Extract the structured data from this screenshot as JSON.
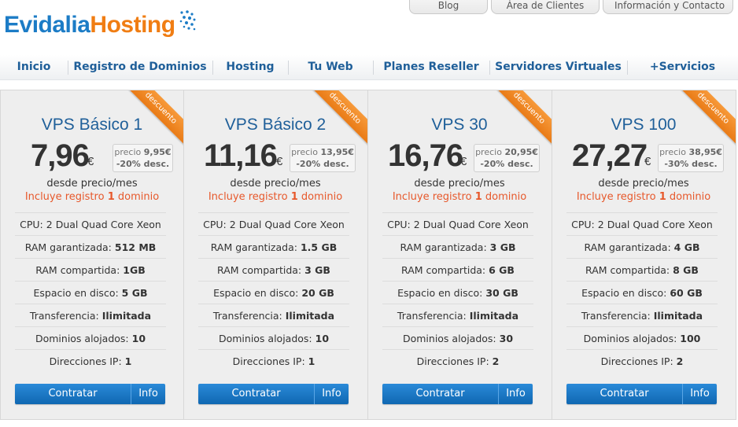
{
  "brand": {
    "part1": "Evidalia",
    "part2": "Hosting"
  },
  "top_tabs": [
    "Blog",
    "Área de Clientes",
    "Información y Contacto"
  ],
  "nav": [
    "Inicio",
    "Registro de Dominios",
    "Hosting",
    "Tu Web",
    "Planes Reseller",
    "Servidores Virtuales",
    "+Servicios"
  ],
  "labels": {
    "ribbon": "descuento",
    "desde": "desde precio/mes",
    "incluye_pre": "Incluye registro ",
    "incluye_num": "1",
    "incluye_post": " dominio",
    "precio_label": "precio",
    "contratar": "Contratar",
    "info": "Info",
    "cpu_label": "CPU:",
    "ram_g_label": "RAM garantizada:",
    "ram_c_label": "RAM compartida:",
    "disk_label": "Espacio en disco:",
    "transfer_label": "Transferencia:",
    "domains_label": "Dominios alojados:",
    "ip_label": "Direcciones IP:"
  },
  "plans": [
    {
      "name": "VPS Básico 1",
      "price": "7,96",
      "currency": "€",
      "old_price": "9,95€",
      "discount": "-20% desc.",
      "cpu": "2 Dual Quad Core Xeon",
      "ram_g": "512 MB",
      "ram_c": "1GB",
      "disk": "5 GB",
      "transfer": "Ilimitada",
      "domains": "10",
      "ips": "1"
    },
    {
      "name": "VPS Básico 2",
      "price": "11,16",
      "currency": "€",
      "old_price": "13,95€",
      "discount": "-20% desc.",
      "cpu": "2 Dual Quad Core Xeon",
      "ram_g": "1.5 GB",
      "ram_c": "3 GB",
      "disk": "20 GB",
      "transfer": "Ilimitada",
      "domains": "10",
      "ips": "1"
    },
    {
      "name": "VPS 30",
      "price": "16,76",
      "currency": "€",
      "old_price": "20,95€",
      "discount": "-20% desc.",
      "cpu": "2 Dual Quad Core Xeon",
      "ram_g": "3 GB",
      "ram_c": "6 GB",
      "disk": "30 GB",
      "transfer": "Ilimitada",
      "domains": "30",
      "ips": "2"
    },
    {
      "name": "VPS 100",
      "price": "27,27",
      "currency": "€",
      "old_price": "38,95€",
      "discount": "-30% desc.",
      "cpu": "2 Dual Quad Core Xeon",
      "ram_g": "4 GB",
      "ram_c": "8 GB",
      "disk": "60 GB",
      "transfer": "Ilimitada",
      "domains": "100",
      "ips": "2"
    }
  ],
  "colors": {
    "brand_blue": "#1c7cc6",
    "brand_orange": "#f07d13",
    "nav_text": "#1f5f99",
    "ribbon": "#f08a25",
    "button": "#1a78c6",
    "incluye": "#e7582b"
  }
}
